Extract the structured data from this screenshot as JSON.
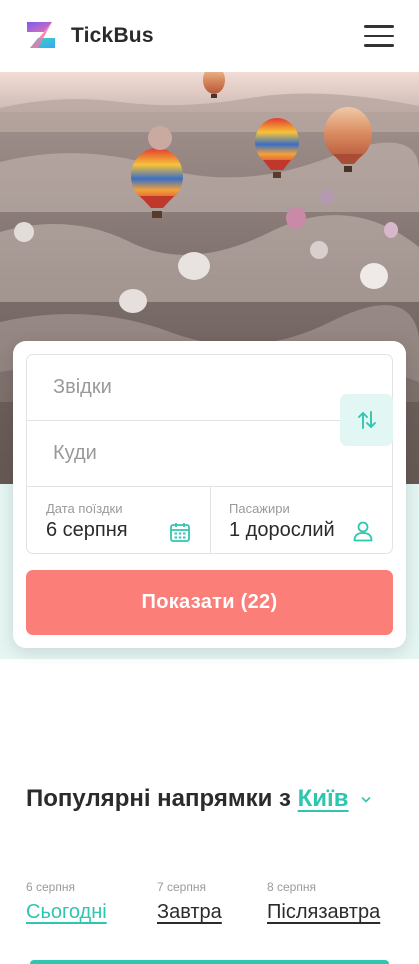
{
  "header": {
    "brand": "TickBus",
    "logo_icon": "tickbus-logo-icon",
    "menu_icon": "hamburger-menu-icon"
  },
  "hero": {
    "image": "hot-air-balloons-cappadocia-photo"
  },
  "search": {
    "from_placeholder": "Звідки",
    "to_placeholder": "Куди",
    "swap_icon": "swap-arrows-icon",
    "date_label": "Дата поїздки",
    "date_value": "6 серпня",
    "date_icon": "calendar-icon",
    "passengers_label": "Пасажири",
    "passengers_value": "1 дорослий",
    "passengers_icon": "user-icon",
    "submit_label": "Показати (22)"
  },
  "popular": {
    "title": "Популярні напрямки з",
    "city": "Київ",
    "city_icon": "chevron-down-icon",
    "days": [
      {
        "date": "6 серпня",
        "label": "Сьогодні",
        "active": true
      },
      {
        "date": "7 серпня",
        "label": "Завтра",
        "active": false
      },
      {
        "date": "8 серпня",
        "label": "Післязавтра",
        "active": false
      }
    ]
  },
  "colors": {
    "accent": "#2fc6b0",
    "button": "#fb7e79",
    "mint_background": "#e4f5f2"
  }
}
